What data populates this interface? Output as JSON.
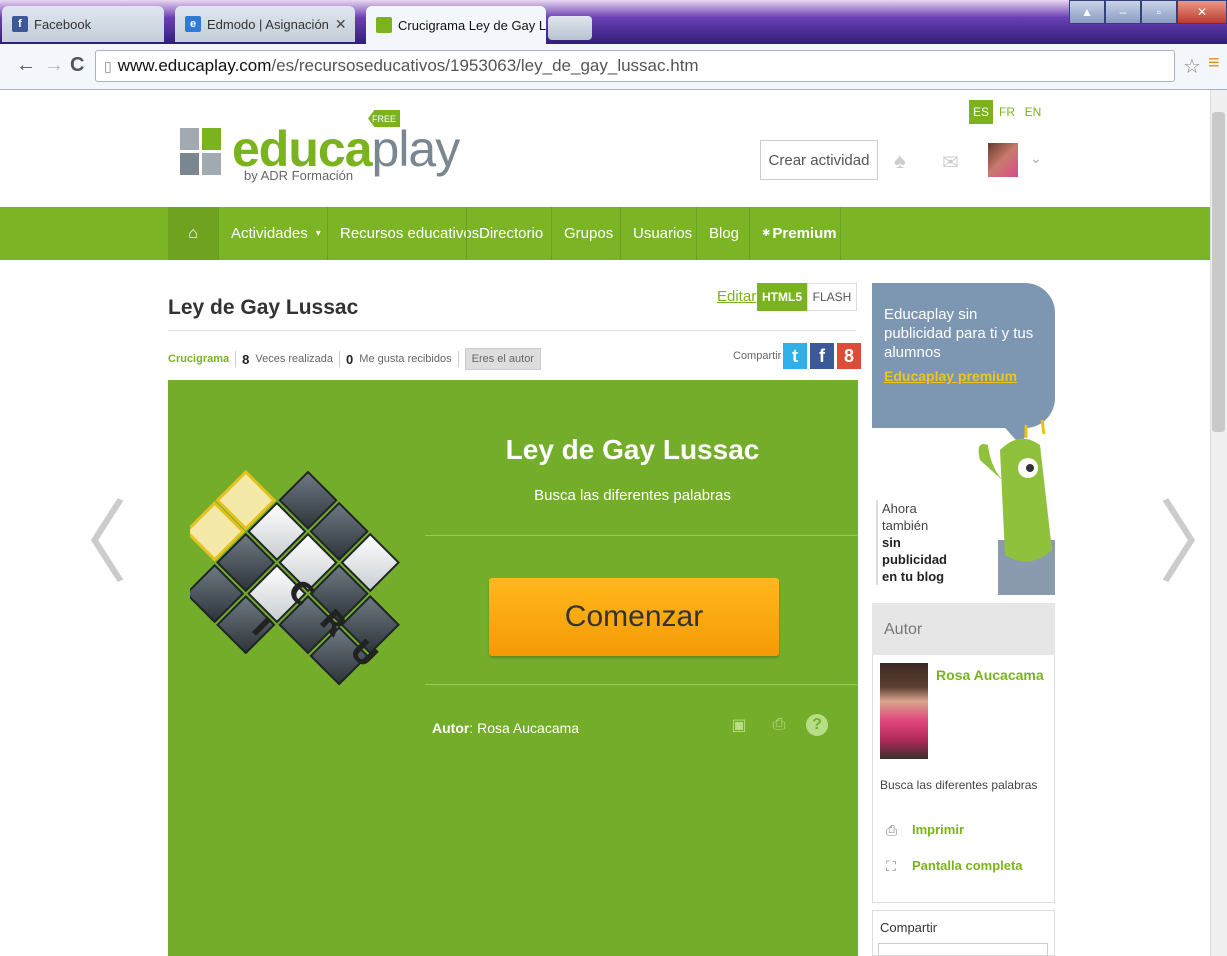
{
  "browser": {
    "tabs": [
      {
        "label": "Facebook",
        "favicon": "facebook-icon",
        "color": "#3b5998"
      },
      {
        "label": "Edmodo | Asignación",
        "favicon": "edmodo-icon",
        "color": "#2f7bd4"
      },
      {
        "label": "Crucigrama Ley de Gay Lu",
        "favicon": "educaplay-icon",
        "color": "#7ab31e"
      }
    ],
    "url_host": "www.educaplay.com",
    "url_path": "/es/recursoseducativos/1953063/ley_de_gay_lussac.htm"
  },
  "header": {
    "logo_main": "educa",
    "logo_play": "play",
    "logo_sub": "by ADR Formación",
    "free_badge": "FREE",
    "languages": [
      "ES",
      "FR",
      "EN"
    ],
    "active_language": "ES",
    "create_button": "Crear actividad"
  },
  "nav": {
    "items": [
      "Actividades",
      "Recursos educativos",
      "Directorio",
      "Grupos",
      "Usuarios",
      "Blog",
      "Premium"
    ]
  },
  "activity": {
    "title": "Ley de Gay Lussac",
    "edit_link": "Editar",
    "html5_label": "HTML5",
    "flash_label": "FLASH",
    "type": "Crucigrama",
    "times_played_count": "8",
    "times_played_label": "Veces realizada",
    "likes_count": "0",
    "likes_label": "Me gusta recibidos",
    "author_badge": "Eres el autor",
    "share_label": "Compartir"
  },
  "panel": {
    "title": "Ley de Gay Lussac",
    "subtitle": "Busca las diferentes palabras",
    "start_button": "Comenzar",
    "author_label": "Autor",
    "author_name": "Rosa Aucacama",
    "crossword_letters": [
      "C",
      "R",
      "U",
      "I"
    ]
  },
  "sidebar": {
    "promo_text": "Educaplay sin publicidad para ti y tus alumnos",
    "promo_link": "Educaplay premium",
    "blog_line1": "Ahora también",
    "blog_line2": "sin publicidad",
    "blog_line3": "en tu blog",
    "author_heading": "Autor",
    "author_name": "Rosa Aucacama",
    "description": "Busca las diferentes palabras",
    "print_link": "Imprimir",
    "fullscreen_link": "Pantalla completa",
    "share_heading": "Compartir"
  },
  "colors": {
    "brand_green": "#7ab31e",
    "nav_green": "#7bb424",
    "panel_green": "#74ad2a",
    "start_orange": "#f7a30c",
    "promo_blue": "#7d97b3"
  }
}
